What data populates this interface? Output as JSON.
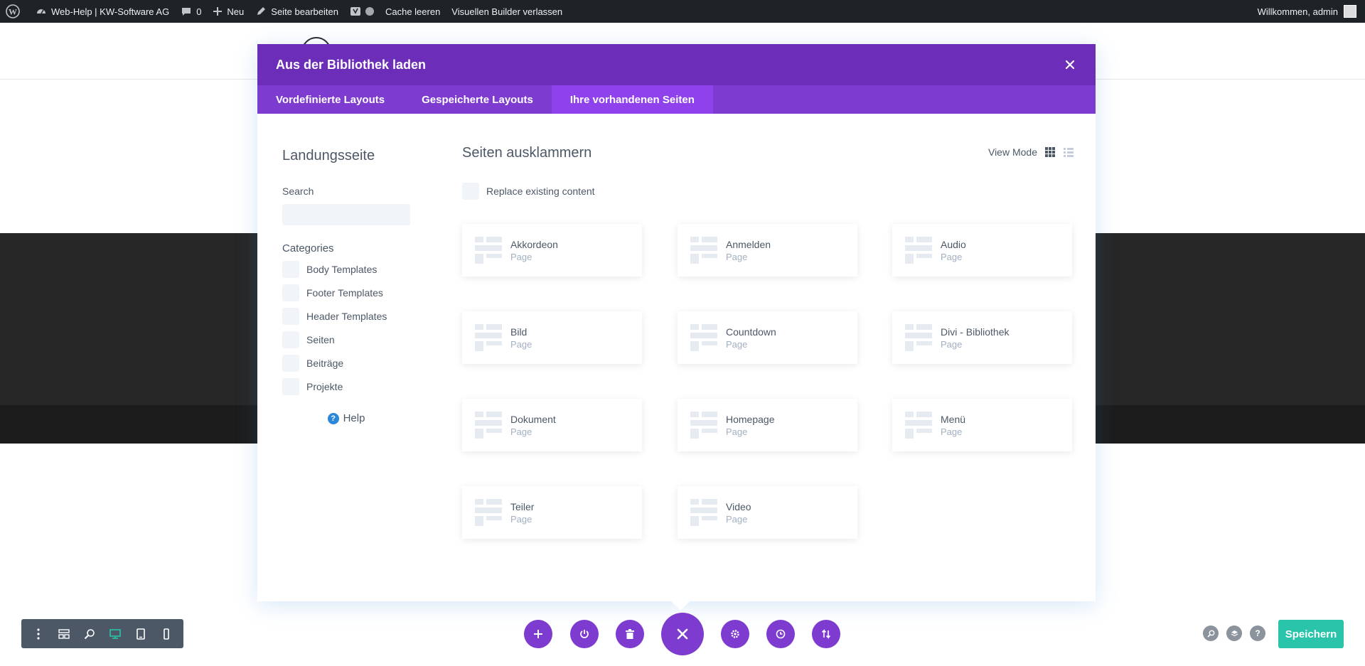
{
  "adminbar": {
    "site_name": "Web-Help | KW-Software AG",
    "comments_count": "0",
    "new_label": "Neu",
    "edit_label": "Seite bearbeiten",
    "cache_label": "Cache leeren",
    "exit_builder_label": "Visuellen Builder verlassen",
    "welcome": "Willkommen, admin"
  },
  "modal": {
    "title": "Aus der Bibliothek laden",
    "tabs": [
      {
        "label": "Vordefinierte Layouts",
        "active": false
      },
      {
        "label": "Gespeicherte Layouts",
        "active": false
      },
      {
        "label": "Ihre vorhandenen Seiten",
        "active": true
      }
    ],
    "sidebar": {
      "title": "Landungsseite",
      "search_label": "Search",
      "search_placeholder": "",
      "categories_label": "Categories",
      "categories": [
        "Body Templates",
        "Footer Templates",
        "Header Templates",
        "Seiten",
        "Beiträge",
        "Projekte"
      ],
      "help_label": "Help"
    },
    "main": {
      "title": "Seiten ausklammern",
      "view_mode_label": "View Mode",
      "replace_label": "Replace existing content",
      "cards": [
        {
          "name": "Akkordeon",
          "type": "Page"
        },
        {
          "name": "Anmelden",
          "type": "Page"
        },
        {
          "name": "Audio",
          "type": "Page"
        },
        {
          "name": "Bild",
          "type": "Page"
        },
        {
          "name": "Countdown",
          "type": "Page"
        },
        {
          "name": "Divi - Bibliothek",
          "type": "Page"
        },
        {
          "name": "Dokument",
          "type": "Page"
        },
        {
          "name": "Homepage",
          "type": "Page"
        },
        {
          "name": "Menü",
          "type": "Page"
        },
        {
          "name": "Teiler",
          "type": "Page"
        },
        {
          "name": "Video",
          "type": "Page"
        }
      ]
    }
  },
  "footer": {
    "save_label": "Speichern"
  },
  "colors": {
    "purple_dark": "#6c2eb9",
    "purple_tab": "#7d3bcf",
    "purple_active": "#8f42ec",
    "save_green": "#29c4a9",
    "adminbar": "#1d2327"
  }
}
